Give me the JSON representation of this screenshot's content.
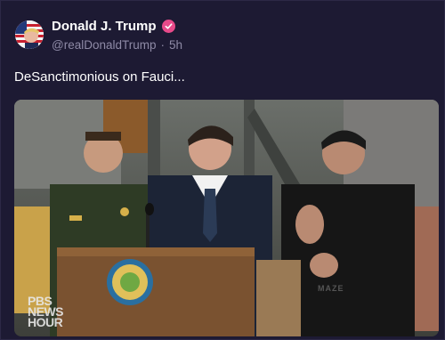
{
  "post": {
    "author_name": "Donald J. Trump",
    "handle": "@realDonaldTrump",
    "separator": "·",
    "time": "5h",
    "text": "DeSanctimonious on Fauci..."
  },
  "media": {
    "watermark_line1": "PBS",
    "watermark_line2": "NEWS",
    "watermark_line3": "HOUR",
    "podium_text": "MAZE"
  },
  "icons": {
    "verified": "verified-badge-icon",
    "avatar": "profile-avatar"
  },
  "colors": {
    "background": "#1d1a33",
    "verified_badge": "#e84a8a",
    "secondary_text": "#8e8aa6"
  }
}
